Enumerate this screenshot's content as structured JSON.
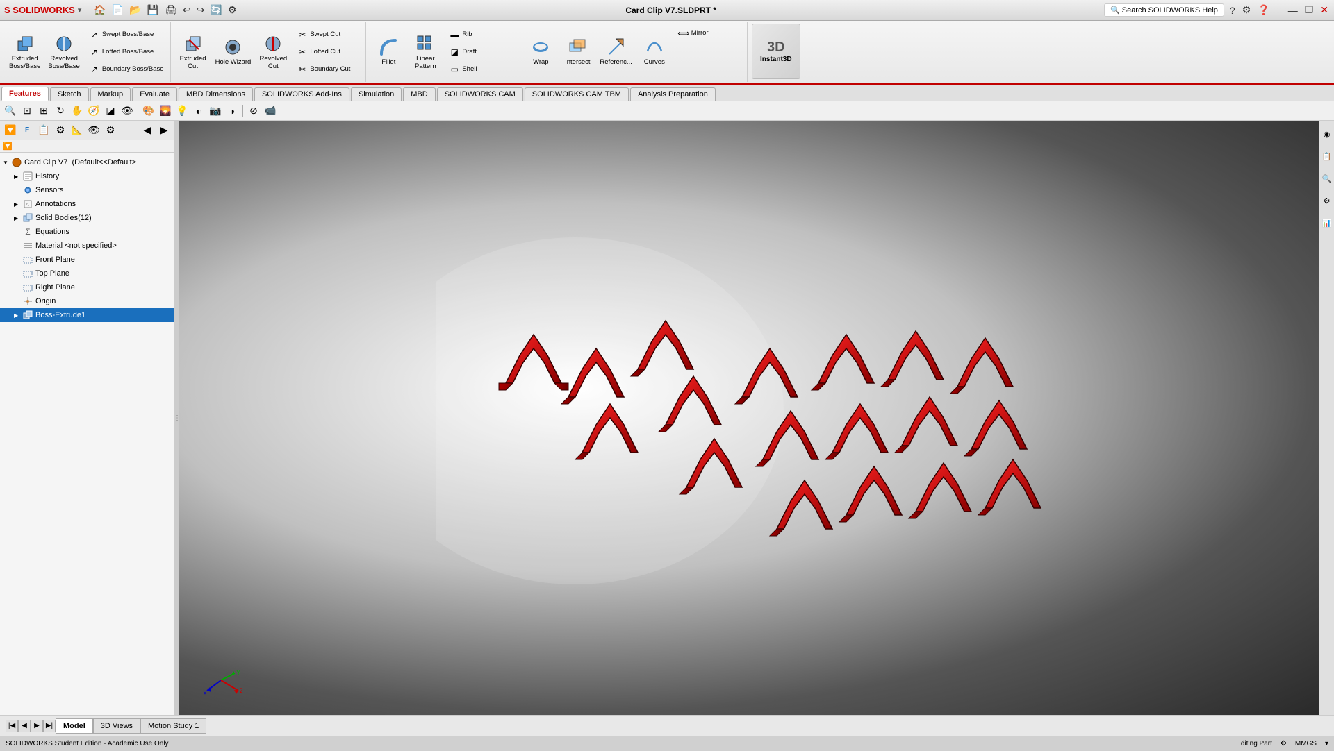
{
  "titlebar": {
    "logo": "SW",
    "title": "Card Clip V7.SLDPRT *",
    "search_placeholder": "Search SOLIDWORKS Help",
    "window_controls": [
      "minimize",
      "restore",
      "close"
    ],
    "quick_access": [
      "home",
      "new",
      "open",
      "save",
      "print",
      "undo",
      "redo",
      "rebuild"
    ]
  },
  "ribbon": {
    "groups": [
      {
        "name": "boss-base-group",
        "buttons": [
          {
            "id": "extruded-boss",
            "label": "Extruded\nBoss/Base",
            "size": "large",
            "icon": "⬛"
          },
          {
            "id": "revolved-boss",
            "label": "Revolved\nBoss/Base",
            "size": "large",
            "icon": "🔄"
          }
        ],
        "small_buttons": [
          {
            "id": "swept-boss",
            "label": "Swept Boss/Base",
            "icon": "↗"
          },
          {
            "id": "lofted-boss",
            "label": "Lofted Boss/Base",
            "icon": "↗"
          },
          {
            "id": "boundary-boss",
            "label": "Boundary Boss/Base",
            "icon": "↗"
          }
        ]
      },
      {
        "name": "cut-group",
        "buttons": [
          {
            "id": "extruded-cut",
            "label": "Extruded\nCut",
            "size": "large",
            "icon": "⬛"
          },
          {
            "id": "hole-wizard",
            "label": "Hole Wizard",
            "size": "large",
            "icon": "⭕"
          },
          {
            "id": "revolved-cut",
            "label": "Revolved\nCut",
            "size": "large",
            "icon": "🔄"
          }
        ],
        "small_buttons": [
          {
            "id": "swept-cut",
            "label": "Swept Cut",
            "icon": "✂"
          },
          {
            "id": "lofted-cut",
            "label": "Lofted Cut",
            "icon": "✂"
          },
          {
            "id": "boundary-cut",
            "label": "Boundary Cut",
            "icon": "✂"
          }
        ]
      },
      {
        "name": "feature-group",
        "buttons": [
          {
            "id": "fillet",
            "label": "Fillet",
            "size": "large",
            "icon": "◉"
          },
          {
            "id": "linear-pattern",
            "label": "Linear\nPattern",
            "size": "large",
            "icon": "⊞"
          }
        ],
        "small_buttons": [
          {
            "id": "rib",
            "label": "Rib",
            "icon": "▬"
          },
          {
            "id": "draft",
            "label": "Draft",
            "icon": "◪"
          },
          {
            "id": "shell",
            "label": "Shell",
            "icon": "▭"
          }
        ]
      },
      {
        "name": "misc-group",
        "buttons": [
          {
            "id": "wrap",
            "label": "Wrap",
            "size": "large",
            "icon": "🌀"
          },
          {
            "id": "intersect",
            "label": "Intersect",
            "size": "large",
            "icon": "⊕"
          },
          {
            "id": "reference-geometry",
            "label": "Referenc...",
            "size": "large",
            "icon": "📐"
          },
          {
            "id": "curves",
            "label": "Curves",
            "size": "large",
            "icon": "〰"
          }
        ],
        "small_buttons": [
          {
            "id": "mirror",
            "label": "Mirror",
            "icon": "⟺"
          }
        ]
      },
      {
        "name": "instant3d-group",
        "buttons": [
          {
            "id": "instant3d",
            "label": "Instant3D",
            "size": "large",
            "icon": "3D",
            "special": true
          }
        ]
      }
    ]
  },
  "tabs": [
    {
      "id": "features",
      "label": "Features",
      "active": true
    },
    {
      "id": "sketch",
      "label": "Sketch"
    },
    {
      "id": "markup",
      "label": "Markup"
    },
    {
      "id": "evaluate",
      "label": "Evaluate"
    },
    {
      "id": "mbd-dimensions",
      "label": "MBD Dimensions"
    },
    {
      "id": "solidworks-addins",
      "label": "SOLIDWORKS Add-Ins"
    },
    {
      "id": "simulation",
      "label": "Simulation"
    },
    {
      "id": "mbd",
      "label": "MBD"
    },
    {
      "id": "solidworks-cam",
      "label": "SOLIDWORKS CAM"
    },
    {
      "id": "solidworks-cam-tbm",
      "label": "SOLIDWORKS CAM TBM"
    },
    {
      "id": "analysis-prep",
      "label": "Analysis Preparation"
    }
  ],
  "sidebar": {
    "toolbar_buttons": [
      "filter",
      "history",
      "features",
      "orient",
      "display",
      "appearance",
      "arrow-left",
      "arrow-right"
    ],
    "tree": [
      {
        "id": "root",
        "label": "Card Clip V7  (Default<<Default>",
        "icon": "🔧",
        "level": 0,
        "expanded": true,
        "has_children": true
      },
      {
        "id": "history",
        "label": "History",
        "icon": "📋",
        "level": 1,
        "expanded": false,
        "has_children": true
      },
      {
        "id": "sensors",
        "label": "Sensors",
        "icon": "📡",
        "level": 1,
        "expanded": false,
        "has_children": false
      },
      {
        "id": "annotations",
        "label": "Annotations",
        "icon": "📝",
        "level": 1,
        "expanded": false,
        "has_children": true
      },
      {
        "id": "solid-bodies",
        "label": "Solid Bodies(12)",
        "icon": "⬜",
        "level": 1,
        "expanded": false,
        "has_children": true
      },
      {
        "id": "equations",
        "label": "Equations",
        "icon": "Σ",
        "level": 1,
        "expanded": false,
        "has_children": false
      },
      {
        "id": "material",
        "label": "Material <not specified>",
        "icon": "≡",
        "level": 1,
        "expanded": false,
        "has_children": false
      },
      {
        "id": "front-plane",
        "label": "Front Plane",
        "icon": "▭",
        "level": 1,
        "expanded": false,
        "has_children": false
      },
      {
        "id": "top-plane",
        "label": "Top Plane",
        "icon": "▭",
        "level": 1,
        "expanded": false,
        "has_children": false
      },
      {
        "id": "right-plane",
        "label": "Right Plane",
        "icon": "▭",
        "level": 1,
        "expanded": false,
        "has_children": false
      },
      {
        "id": "origin",
        "label": "Origin",
        "icon": "✚",
        "level": 1,
        "expanded": false,
        "has_children": false
      },
      {
        "id": "boss-extrude1",
        "label": "Boss-Extrude1",
        "icon": "⬛",
        "level": 1,
        "expanded": false,
        "has_children": false,
        "highlighted": true
      }
    ]
  },
  "viewport": {
    "model_name": "Card Clip V7 3D Model",
    "background_color": "dark gradient"
  },
  "bottom_tabs": [
    {
      "id": "model",
      "label": "Model",
      "active": true
    },
    {
      "id": "3d-views",
      "label": "3D Views"
    },
    {
      "id": "motion-study-1",
      "label": "Motion Study 1"
    }
  ],
  "statusbar": {
    "left": "SOLIDWORKS Student Edition - Academic Use Only",
    "right_items": [
      "Editing Part",
      "MMGS",
      "⚙"
    ]
  },
  "colors": {
    "accent_red": "#cc0000",
    "highlight_blue": "#1a6fbd",
    "toolbar_bg": "#f0f0f0",
    "sidebar_bg": "#f5f5f5"
  }
}
